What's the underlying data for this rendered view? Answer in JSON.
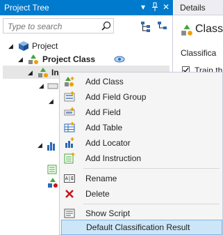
{
  "project_tree": {
    "title": "Project Tree",
    "search_placeholder": "Type to search",
    "nodes": {
      "project": "Project",
      "project_class": "Project Class",
      "selected_child": "In"
    }
  },
  "details": {
    "tab_label": "Details",
    "class_heading": "Class",
    "classification_label": "Classifica",
    "train_checkbox_label": "Train th"
  },
  "context_menu": {
    "add_class": "Add Class",
    "add_field_group": "Add Field Group",
    "add_field": "Add Field",
    "add_table": "Add Table",
    "add_locator": "Add Locator",
    "add_instruction": "Add Instruction",
    "rename_icon_text": "A|E",
    "rename": "Rename",
    "delete": "Delete",
    "show_script": "Show Script",
    "default_classification_result": "Default Classification Result"
  },
  "colors": {
    "titlebar": "#007acc",
    "highlight": "#cde6f7",
    "highlight_border": "#7eb4ea",
    "delete_red": "#c4161c"
  }
}
